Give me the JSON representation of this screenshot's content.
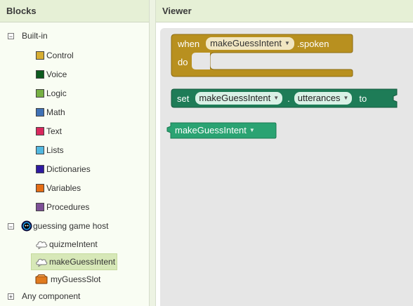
{
  "blocks_panel": {
    "title": "Blocks",
    "builtin": {
      "label": "Built-in",
      "items": [
        {
          "label": "Control",
          "color": "#d6ad32"
        },
        {
          "label": "Voice",
          "color": "#0d5a1e"
        },
        {
          "label": "Logic",
          "color": "#76b043"
        },
        {
          "label": "Math",
          "color": "#3f71b5"
        },
        {
          "label": "Text",
          "color": "#d8285d"
        },
        {
          "label": "Lists",
          "color": "#52b8e0"
        },
        {
          "label": "Dictionaries",
          "color": "#2e1aa0"
        },
        {
          "label": "Variables",
          "color": "#e46d14"
        },
        {
          "label": "Procedures",
          "color": "#7d4f96"
        }
      ]
    },
    "component": {
      "label": "guessing game host",
      "children": [
        {
          "label": "quizmeIntent",
          "icon": "cloud-icon"
        },
        {
          "label": "makeGuessIntent",
          "icon": "cloud-icon",
          "selected": true
        },
        {
          "label": "myGuessSlot",
          "icon": "slot-icon"
        }
      ]
    },
    "any_component": {
      "label": "Any component"
    }
  },
  "viewer": {
    "title": "Viewer",
    "when_block": {
      "when": "when",
      "intent": "makeGuessIntent",
      "event": ".spoken",
      "do": "do",
      "color": "#b8901f"
    },
    "set_block": {
      "set": "set",
      "intent": "makeGuessIntent",
      "dot": ".",
      "property": "utterances",
      "to": "to",
      "color": "#1e7c57"
    },
    "getter_block": {
      "intent": "makeGuessIntent",
      "color": "#2aa372"
    }
  }
}
